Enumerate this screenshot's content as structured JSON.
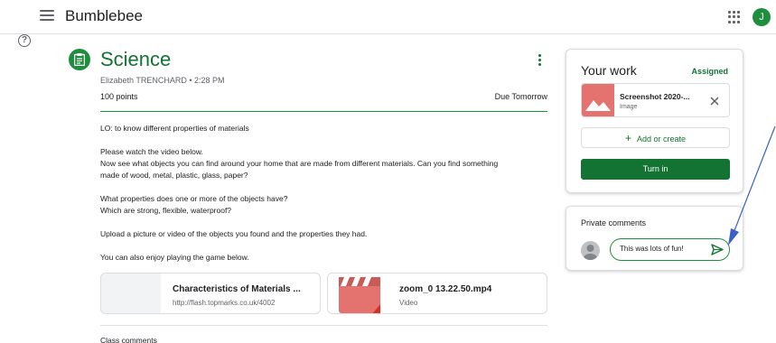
{
  "header": {
    "app_name": "Bumblebee",
    "avatar_letter": "J"
  },
  "assignment": {
    "title": "Science",
    "author": "Elizabeth TRENCHARD • 2:28 PM",
    "points": "100 points",
    "due": "Due Tomorrow",
    "description": [
      "LO: to know different properties of materials",
      "Please watch the video below.",
      "Now see what objects you can find around your home that are made from different materials. Can you find something",
      "made of wood, metal, plastic, glass, paper?",
      "What properties does one or more of the objects have?",
      "Which are strong, flexible, waterproof?",
      "Upload a picture or video of the objects you found and the properties they had.",
      "You can also enjoy playing the game below."
    ],
    "attachments": [
      {
        "title": "Characteristics of Materials ...",
        "subtitle": "http://flash.topmarks.co.uk/4002"
      },
      {
        "title": "zoom_0 13.22.50.mp4",
        "subtitle": "Video"
      }
    ],
    "class_comments_label": "Class comments"
  },
  "your_work": {
    "title": "Your work",
    "status": "Assigned",
    "file": {
      "name": "Screenshot 2020-...",
      "type": "Image"
    },
    "add_label": "Add or create",
    "turn_in_label": "Turn in"
  },
  "private_comments": {
    "title": "Private comments",
    "input_value": "This was lots of fun!"
  },
  "colors": {
    "accent": "#137333",
    "accent_light": "#1e8e3e",
    "thumb_red": "#e4736f",
    "arrow": "#3a5fc8"
  }
}
